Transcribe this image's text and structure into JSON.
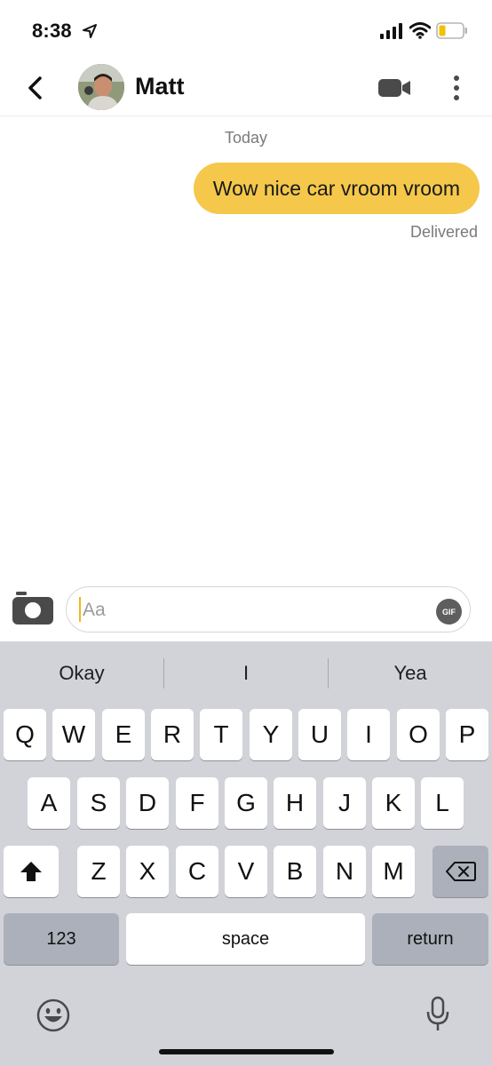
{
  "status_bar": {
    "time": "8:38"
  },
  "header": {
    "contact_name": "Matt"
  },
  "conversation": {
    "date_label": "Today",
    "messages": [
      {
        "text": "Wow nice car vroom vroom",
        "status": "Delivered"
      }
    ]
  },
  "composer": {
    "placeholder": "Aa",
    "gif_label": "GIF"
  },
  "keyboard": {
    "suggestions": [
      "Okay",
      "I",
      "Yea"
    ],
    "row1": [
      "Q",
      "W",
      "E",
      "R",
      "T",
      "Y",
      "U",
      "I",
      "O",
      "P"
    ],
    "row2": [
      "A",
      "S",
      "D",
      "F",
      "G",
      "H",
      "J",
      "K",
      "L"
    ],
    "row3": [
      "Z",
      "X",
      "C",
      "V",
      "B",
      "N",
      "M"
    ],
    "numbers_label": "123",
    "space_label": "space",
    "return_label": "return"
  },
  "colors": {
    "bubble": "#f5c84b",
    "keyboard_bg": "#d1d3d9",
    "caret": "#f1b718"
  }
}
